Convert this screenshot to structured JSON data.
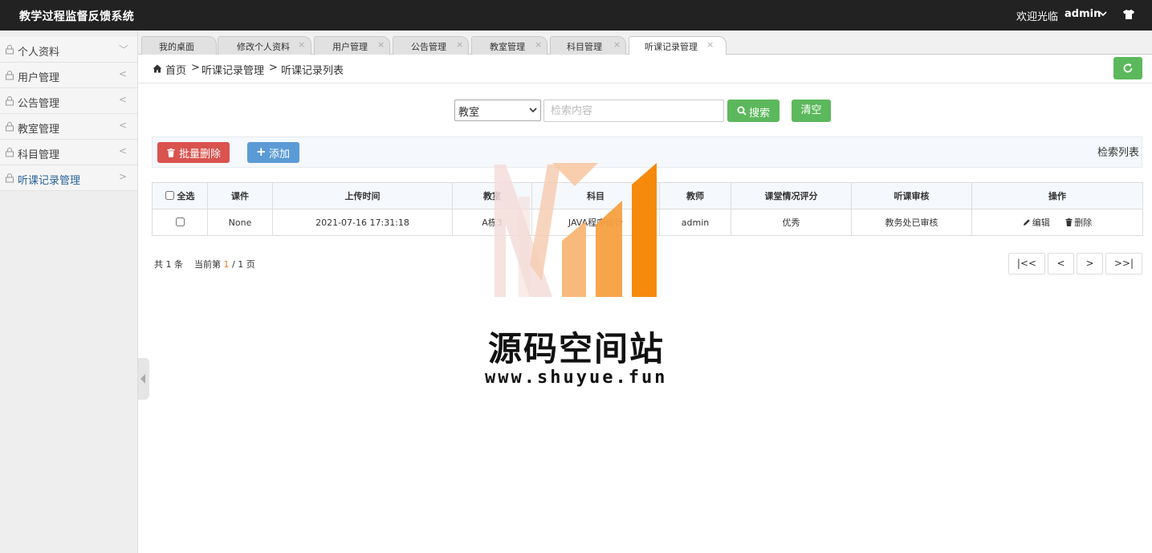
{
  "header": {
    "app_title": "教学过程监督反馈系统",
    "welcome": "欢迎光临",
    "username": "admin"
  },
  "sidebar": {
    "items": [
      {
        "label": "个人资料",
        "arrow": "﹀"
      },
      {
        "label": "用户管理",
        "arrow": "<"
      },
      {
        "label": "公告管理",
        "arrow": "<"
      },
      {
        "label": "教室管理",
        "arrow": "<"
      },
      {
        "label": "科目管理",
        "arrow": "<"
      },
      {
        "label": "听课记录管理",
        "arrow": ">"
      }
    ]
  },
  "tabs": [
    {
      "label": "我的桌面",
      "closable": false
    },
    {
      "label": "修改个人资料",
      "closable": true
    },
    {
      "label": "用户管理",
      "closable": true
    },
    {
      "label": "公告管理",
      "closable": true
    },
    {
      "label": "教室管理",
      "closable": true
    },
    {
      "label": "科目管理",
      "closable": true
    },
    {
      "label": "听课记录管理",
      "closable": true,
      "active": true
    }
  ],
  "breadcrumb": {
    "home": "首页",
    "sep1": ">",
    "level1": "听课记录管理",
    "sep2": ">",
    "level2": "听课记录列表"
  },
  "search": {
    "field_selected": "教室",
    "placeholder": "检索内容",
    "search_label": "搜索",
    "clear_label": "清空"
  },
  "toolbar": {
    "batch_delete_label": "批量删除",
    "add_label": "添加",
    "list_label": "检索列表"
  },
  "table": {
    "select_all": "全选",
    "columns": [
      "课件",
      "上传时间",
      "教室",
      "科目",
      "教师",
      "课堂情况评分",
      "听课审核",
      "操作"
    ],
    "rows": [
      {
        "courseware": "None",
        "upload_time": "2021-07-16 17:31:18",
        "classroom": "A栋3",
        "subject": "JAVA程序设计",
        "teacher": "admin",
        "score": "优秀",
        "review": "教务处已审核",
        "edit_label": "编辑",
        "delete_label": "删除"
      }
    ]
  },
  "pager": {
    "total_prefix": "共",
    "total": "1",
    "total_suffix": "条",
    "current_prefix": "当前第",
    "current_page": "1",
    "page_sep": "/",
    "total_pages": "1",
    "page_suffix": "页",
    "first": "|<<",
    "prev": "<",
    "next": ">",
    "last": ">>|"
  },
  "watermark": {
    "title": "源码空间站",
    "url": "www.shuyue.fun"
  },
  "colors": {
    "header_bg": "#222222",
    "success": "#5cb85c",
    "danger": "#d9534f",
    "primary": "#5b9bd5",
    "watermark_orange": "#f7931e"
  }
}
